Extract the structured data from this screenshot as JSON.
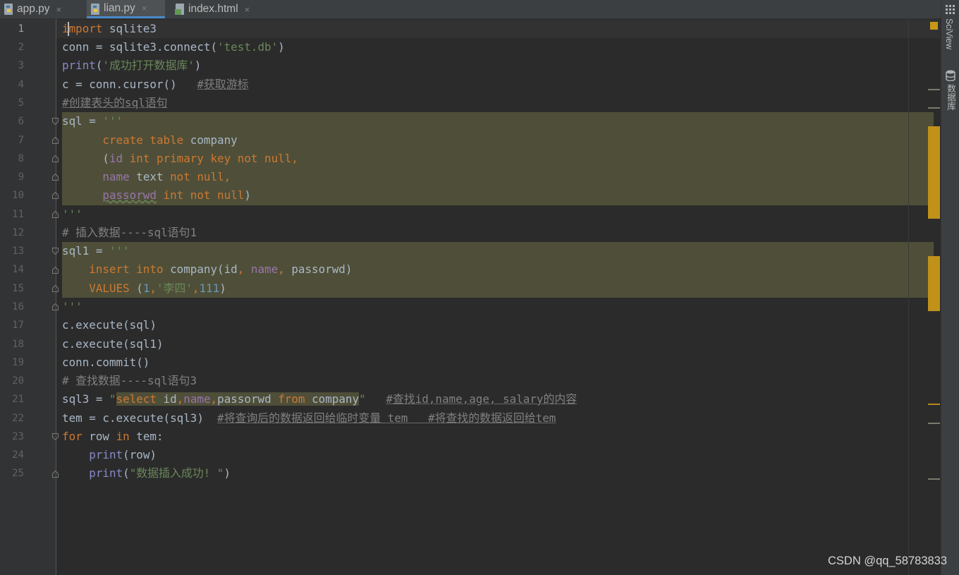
{
  "tabs": [
    {
      "label": "app.py",
      "icon": "python-file-icon",
      "active": false
    },
    {
      "label": "lian.py",
      "icon": "python-file-icon",
      "active": true
    },
    {
      "label": "index.html",
      "icon": "html-file-icon",
      "active": false
    }
  ],
  "tab_close_glyph": "×",
  "sidebar": {
    "sciview_label": "SciView",
    "database_label": "数据库"
  },
  "gutter": {
    "line_numbers": [
      "1",
      "2",
      "3",
      "4",
      "5",
      "6",
      "7",
      "8",
      "9",
      "10",
      "11",
      "12",
      "13",
      "14",
      "15",
      "16",
      "17",
      "18",
      "19",
      "20",
      "21",
      "22",
      "23",
      "24",
      "25"
    ],
    "current_line": 1
  },
  "code": {
    "l1a": "import",
    "l1b": " sqlite3",
    "l2a": "conn = sqlite3.connect(",
    "l2b": "'test.db'",
    "l2c": ")",
    "l3a": "print",
    "l3b": "(",
    "l3c": "'成功打开数据库'",
    "l3d": ")",
    "l4a": "c = conn.cursor()   ",
    "l4b": "#获取游标",
    "l5": "#创建表头的sql语句",
    "l6a": "sql = ",
    "l6b": "'''",
    "l7a": "      create table ",
    "l7b": "company",
    "l8a": "      (",
    "l8b": "id ",
    "l8c": "int primary key not null,",
    "l9a": "      ",
    "l9b": "name ",
    "l9c": "text ",
    "l9d": "not null,",
    "l10a": "      ",
    "l10b": "passorwd",
    "l10c": " int not null",
    "l10d": ")",
    "l11": "'''",
    "l12": "# 插入数据----sql语句1",
    "l13a": "sql1 = ",
    "l13b": "'''",
    "l14a": "    insert into ",
    "l14b": "company(id",
    "l14c": ", ",
    "l14d": "name",
    "l14e": ", ",
    "l14f": "passorwd)",
    "l15a": "    VALUES ",
    "l15b": "(",
    "l15c": "1",
    "l15d": ",",
    "l15e": "'李四'",
    "l15f": ",",
    "l15g": "111",
    "l15h": ")",
    "l16": "'''",
    "l17": "c.execute(sql)",
    "l18": "c.execute(sql1)",
    "l19": "conn.commit()",
    "l20": "# 查找数据----sql语句3",
    "l21a": "sql3 = ",
    "l21b": "\"",
    "l21c": "select ",
    "l21d": "id",
    "l21e": ",",
    "l21f": "name",
    "l21g": ",",
    "l21h": "passorwd ",
    "l21i": "from ",
    "l21j": "company",
    "l21k": "\"",
    "l21l": "   ",
    "l21m": "#查找id,name,age, salary的内容",
    "l22a": "tem = c.execute(sql3)  ",
    "l22b": "#将查询后的数据返回给临时变量 tem   #将查找的数据返回给tem",
    "l23a": "for ",
    "l23b": "row ",
    "l23c": "in ",
    "l23d": "tem:",
    "l24a": "    ",
    "l24b": "print",
    "l24c": "(row)",
    "l25a": "    ",
    "l25b": "print",
    "l25c": "(",
    "l25d": "\"数据插入成功! \"",
    "l25e": ")"
  },
  "colors": {
    "background": "#2b2b2b",
    "keyword": "#cc7832",
    "string": "#6a8759",
    "comment": "#808080",
    "builtin": "#8888c6",
    "number": "#6897bb",
    "sql_highlight": "#4f4f39",
    "marker": "#c79717",
    "tab_underline": "#4a88c7"
  },
  "watermark": "CSDN @qq_58783833"
}
